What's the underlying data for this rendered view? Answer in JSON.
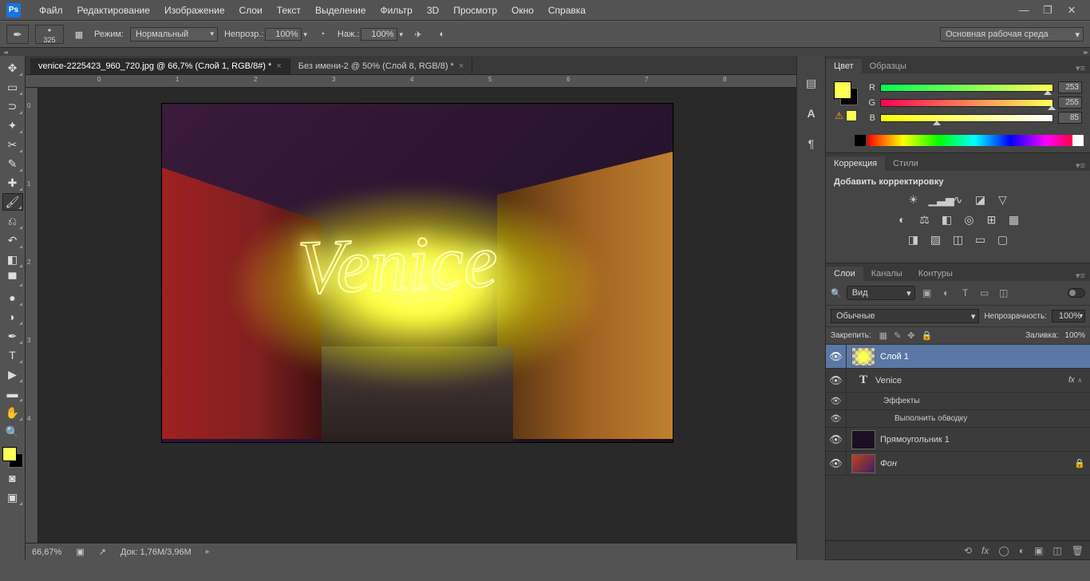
{
  "menu": {
    "items": [
      "Файл",
      "Редактирование",
      "Изображение",
      "Слои",
      "Текст",
      "Выделение",
      "Фильтр",
      "3D",
      "Просмотр",
      "Окно",
      "Справка"
    ]
  },
  "options": {
    "brush_size": "325",
    "mode_label": "Режим:",
    "mode_value": "Нормальный",
    "opacity_label": "Непрозр.:",
    "opacity_value": "100%",
    "flow_label": "Наж.:",
    "flow_value": "100%",
    "workspace": "Основная рабочая среда"
  },
  "tabs": {
    "active": "venice-2225423_960_720.jpg @ 66,7% (Слой 1, RGB/8#) *",
    "inactive": "Без имени-2 @ 50% (Слой 8, RGB/8) *"
  },
  "canvas_text": "Venice",
  "status": {
    "zoom": "66,67%",
    "doc": "Док: 1,76М/3,96М"
  },
  "color": {
    "tab_color": "Цвет",
    "tab_swatches": "Образцы",
    "r_label": "R",
    "r_value": "253",
    "g_label": "G",
    "g_value": "255",
    "b_label": "B",
    "b_value": "85"
  },
  "adjustments": {
    "tab_adj": "Коррекция",
    "tab_styles": "Стили",
    "title": "Добавить корректировку"
  },
  "layers": {
    "tab_layers": "Слои",
    "tab_channels": "Каналы",
    "tab_paths": "Контуры",
    "filter_kind": "Вид",
    "blend_mode": "Обычные",
    "opacity_label": "Непрозрачность:",
    "opacity_value": "100%",
    "lock_label": "Закрепить:",
    "fill_label": "Заливка:",
    "fill_value": "100%",
    "layer1": "Слой 1",
    "layer_venice": "Venice",
    "effects": "Эффекты",
    "stroke": "Выполнить обводку",
    "rect": "Прямоугольник 1",
    "bg": "Фон"
  }
}
